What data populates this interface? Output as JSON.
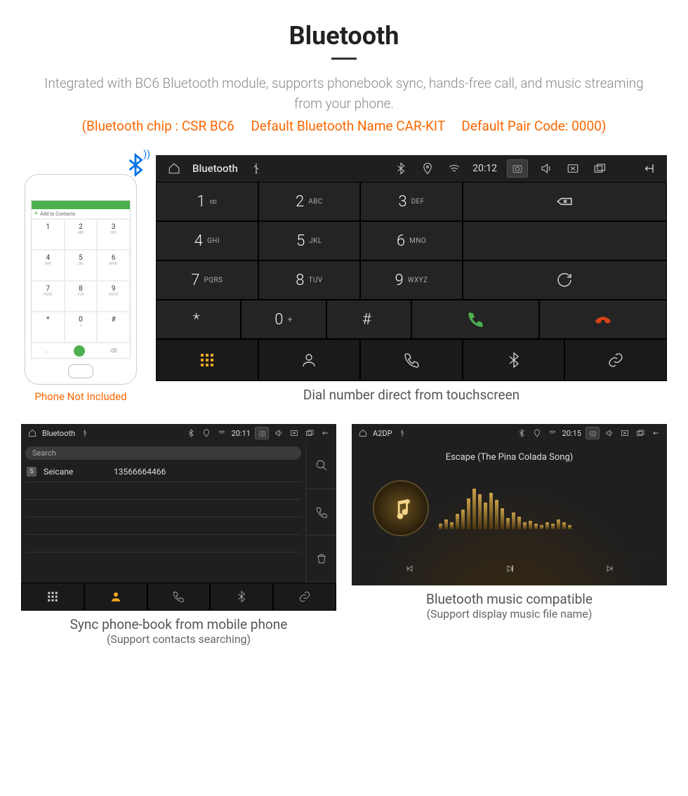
{
  "title": "Bluetooth",
  "desc": "Integrated with BC6 Bluetooth module, supports phonebook sync, hands-free call, and music streaming from your phone.",
  "orange": "(Bluetooth chip : CSR BC6     Default Bluetooth Name CAR-KIT     Default Pair Code: 0000)",
  "phone_note": "Phone Not Included",
  "mock": {
    "add": "Add to Contacts",
    "keys": [
      [
        "1",
        ""
      ],
      [
        "2",
        "ABC"
      ],
      [
        "3",
        "DEF"
      ],
      [
        "4",
        "GHI"
      ],
      [
        "5",
        "JKL"
      ],
      [
        "6",
        "MNO"
      ],
      [
        "7",
        "PQRS"
      ],
      [
        "8",
        "TUV"
      ],
      [
        "9",
        "WXYZ"
      ],
      [
        "*",
        ""
      ],
      [
        "0",
        "+"
      ],
      [
        "#",
        ""
      ]
    ],
    "ctrl_left": "...",
    "ctrl_right": "⌫"
  },
  "dialer": {
    "app": "Bluetooth",
    "time": "20:12",
    "keys": [
      {
        "n": "1",
        "l": "∞"
      },
      {
        "n": "2",
        "l": "ABC"
      },
      {
        "n": "3",
        "l": "DEF"
      },
      {
        "n": "4",
        "l": "GHI"
      },
      {
        "n": "5",
        "l": "JKL"
      },
      {
        "n": "6",
        "l": "MNO"
      },
      {
        "n": "7",
        "l": "PQRS"
      },
      {
        "n": "8",
        "l": "TUV"
      },
      {
        "n": "9",
        "l": "WXYZ"
      },
      {
        "n": "*",
        "l": ""
      },
      {
        "n": "0",
        "l": "+",
        "sup": true
      },
      {
        "n": "#",
        "l": ""
      }
    ]
  },
  "caption1": "Dial number direct from touchscreen",
  "contacts": {
    "app": "Bluetooth",
    "time": "20:11",
    "search": "Search",
    "rows": [
      {
        "tag": "S",
        "name": "Seicane",
        "num": "13566664466"
      }
    ]
  },
  "caption2a": "Sync phone-book from mobile phone",
  "caption2b": "(Support contacts searching)",
  "music": {
    "app": "A2DP",
    "time": "20:15",
    "track": "Escape (The Pina Colada Song)"
  },
  "caption3a": "Bluetooth music compatible",
  "caption3b": "(Support display music file name)"
}
